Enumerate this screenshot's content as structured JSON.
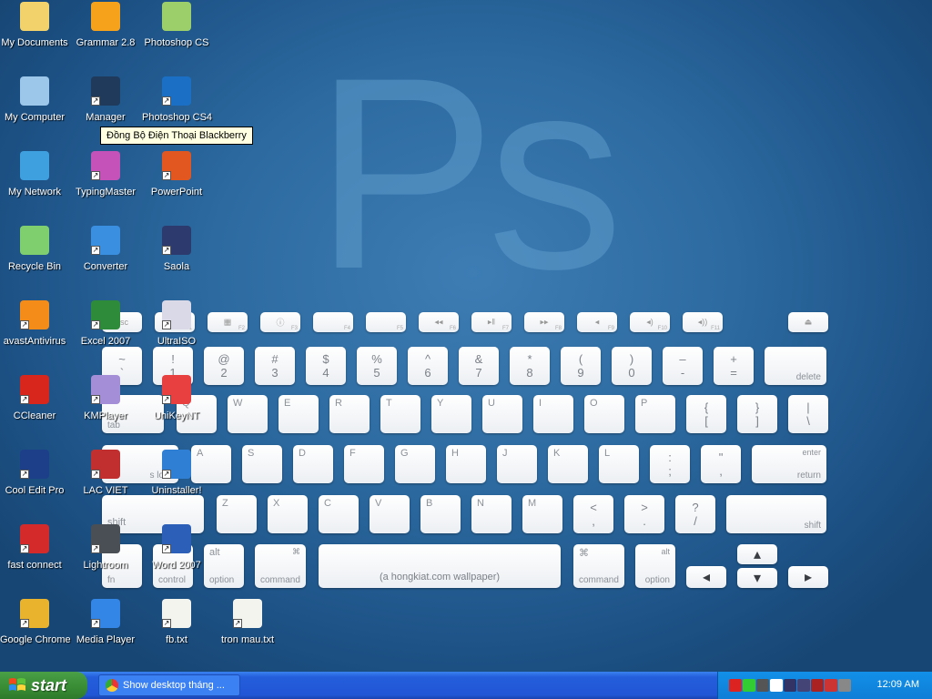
{
  "wallpaper": {
    "logo_text": "Ps",
    "space_label": "(a hongkiat.com wallpaper)"
  },
  "desktop_icons": [
    {
      "label": "My Documents",
      "icon": "folder-icon",
      "color": "#f2d36b"
    },
    {
      "label": "Grammar 2.8",
      "icon": "star-icon",
      "color": "#f7a21b"
    },
    {
      "label": "Photoshop CS",
      "icon": "feather-icon",
      "color": "#9ccf6a"
    },
    {
      "label": "My Computer",
      "icon": "computer-icon",
      "color": "#9cc6ea"
    },
    {
      "label": "Manager",
      "icon": "blackberry-icon",
      "color": "#1f3a5a"
    },
    {
      "label": "Photoshop CS4",
      "icon": "ps-icon",
      "color": "#1b6fc4"
    },
    {
      "label": "My Network",
      "icon": "globe-icon",
      "color": "#3fa0e0"
    },
    {
      "label": "TypingMaster",
      "icon": "typingmaster-icon",
      "color": "#c552b8"
    },
    {
      "label": "PowerPoint",
      "icon": "powerpoint-icon",
      "color": "#e2561f"
    },
    {
      "label": "Recycle Bin",
      "icon": "recycle-bin-icon",
      "color": "#7fcf6e"
    },
    {
      "label": "Converter",
      "icon": "converter-icon",
      "color": "#3b8fe0"
    },
    {
      "label": "Saola",
      "icon": "saola-icon",
      "color": "#2c3a6e"
    },
    {
      "label": "avastAntivirus",
      "icon": "avast-icon",
      "color": "#f48c1a"
    },
    {
      "label": "Excel 2007",
      "icon": "excel-icon",
      "color": "#2e8b3a"
    },
    {
      "label": "UltraISO",
      "icon": "disc-icon",
      "color": "#d9d9e8"
    },
    {
      "label": "CCleaner",
      "icon": "ccleaner-icon",
      "color": "#d8261c"
    },
    {
      "label": "KMPlayer",
      "icon": "kmplayer-icon",
      "color": "#a48ed8"
    },
    {
      "label": "UniKeyNT",
      "icon": "unikey-icon",
      "color": "#e84040"
    },
    {
      "label": "Cool Edit Pro",
      "icon": "cooledit-icon",
      "color": "#1d3f8a"
    },
    {
      "label": "LAC VIET",
      "icon": "lacviet-icon",
      "color": "#c22f2f"
    },
    {
      "label": "Uninstaller!",
      "icon": "uninstaller-icon",
      "color": "#2f7fd4"
    },
    {
      "label": "fast connect",
      "icon": "fastconnect-icon",
      "color": "#d42a2a"
    },
    {
      "label": "Lightroom",
      "icon": "lightroom-icon",
      "color": "#4a4f55"
    },
    {
      "label": "Word 2007",
      "icon": "word-icon",
      "color": "#2b5fb8"
    },
    {
      "label": "Google Chrome",
      "icon": "chrome-icon",
      "color": "#e9b32d"
    },
    {
      "label": "Media Player",
      "icon": "media-player-icon",
      "color": "#3385e6"
    },
    {
      "label": "fb.txt",
      "icon": "text-file-icon",
      "color": "#f4f4ef"
    },
    {
      "label": "tron mau.txt",
      "icon": "text-file-icon",
      "color": "#f4f4ef"
    }
  ],
  "tooltip": "Đồng Bộ Điện Thoại Blackberry",
  "keyboard": {
    "row0": [
      "esc",
      "☼",
      "▦",
      "ⓘ",
      "",
      "",
      "◂◂",
      "▸‖",
      "▸▸",
      "◂",
      "◂)",
      "◂))",
      "⏏"
    ],
    "row1": [
      {
        "top": "~",
        "bot": "`"
      },
      {
        "top": "!",
        "bot": "1"
      },
      {
        "top": "@",
        "bot": "2"
      },
      {
        "top": "#",
        "bot": "3"
      },
      {
        "top": "$",
        "bot": "4"
      },
      {
        "top": "%",
        "bot": "5"
      },
      {
        "top": "^",
        "bot": "6"
      },
      {
        "top": "&",
        "bot": "7"
      },
      {
        "top": "*",
        "bot": "8"
      },
      {
        "top": "(",
        "bot": "9"
      },
      {
        "top": ")",
        "bot": "0"
      },
      {
        "top": "–",
        "bot": "-"
      },
      {
        "top": "+",
        "bot": "="
      }
    ],
    "delete": "delete",
    "tab": "tab",
    "row2_letters": [
      "Q",
      "W",
      "E",
      "R",
      "T",
      "Y",
      "U",
      "I",
      "O",
      "P"
    ],
    "row2_sym": [
      {
        "top": "{",
        "bot": "["
      },
      {
        "top": "}",
        "bot": "]"
      },
      {
        "top": "|",
        "bot": "\\"
      }
    ],
    "caps": "s lock",
    "row3_letters": [
      "A",
      "S",
      "D",
      "F",
      "G",
      "H",
      "J",
      "K",
      "L"
    ],
    "row3_sym": [
      {
        "top": ":",
        "bot": ";"
      },
      {
        "top": "\"",
        "bot": ","
      }
    ],
    "enter_top": "enter",
    "enter_bot": "return",
    "shift": "shift",
    "row4_letters": [
      "Z",
      "X",
      "C",
      "V",
      "B",
      "N",
      "M"
    ],
    "row4_sym": [
      {
        "top": "<",
        "bot": ","
      },
      {
        "top": ">",
        "bot": "."
      },
      {
        "top": "?",
        "bot": "/"
      }
    ],
    "fn": "fn",
    "control": "control",
    "alt": "alt",
    "option": "option",
    "cmd_sym": "⌘",
    "command": "command"
  },
  "taskbar": {
    "start": "start",
    "task_label": "Show desktop tháng ...",
    "clock": "12:09 AM",
    "tray_colors": [
      "#d22",
      "#3c3",
      "#555",
      "#fff",
      "#336",
      "#447",
      "#a22",
      "#c33",
      "#888"
    ]
  }
}
